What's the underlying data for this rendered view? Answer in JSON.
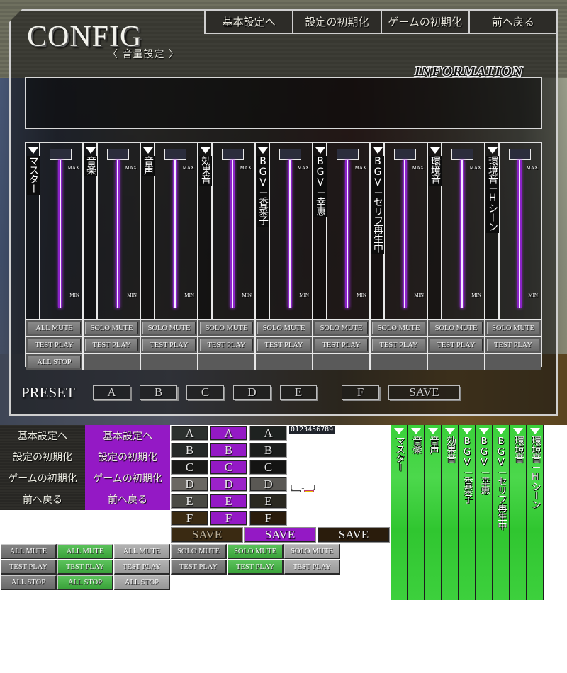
{
  "header": {
    "title": "CONFIG",
    "subtitle": "〈 音量設定 〉"
  },
  "top_nav": [
    {
      "label": "基本設定へ"
    },
    {
      "label": "設定の初期化"
    },
    {
      "label": "ゲームの初期化"
    },
    {
      "label": "前へ戻る"
    }
  ],
  "info": {
    "label": "INFORMATION",
    "text": ""
  },
  "mixer": {
    "max_label": "MAX",
    "min_label": "MIN",
    "channels": [
      {
        "name": "マスター"
      },
      {
        "name": "音楽"
      },
      {
        "name": "音声"
      },
      {
        "name": "効果音"
      },
      {
        "name": "BGV－香菜子"
      },
      {
        "name": "BGV－幸恵"
      },
      {
        "name": "BGV－セリフ再生中"
      },
      {
        "name": "環境音"
      },
      {
        "name": "環境音－Hシーン"
      }
    ],
    "all_mute": "ALL MUTE",
    "solo_mute": "SOLO MUTE",
    "test_play": "TEST PLAY",
    "all_stop": "ALL STOP"
  },
  "preset": {
    "label": "PRESET",
    "slots": [
      "A",
      "B",
      "C",
      "D",
      "E",
      "F"
    ],
    "save": "SAVE"
  },
  "sprites": {
    "nav_items": [
      "基本設定へ",
      "設定の初期化",
      "ゲームの初期化",
      "前へ戻る"
    ],
    "letters": [
      "A",
      "B",
      "C",
      "D",
      "E",
      "F"
    ],
    "digits": "0123456789",
    "save": "SAVE",
    "all_mute": "ALL MUTE",
    "solo_mute": "SOLO MUTE",
    "test_play": "TEST PLAY",
    "all_stop": "ALL STOP",
    "channel_names": [
      "マスター",
      "音楽",
      "音声",
      "効果音",
      "BGV－香菜子",
      "BGV－幸恵",
      "BGV－セリフ再生中",
      "環境音",
      "環境音－Hシーン"
    ]
  },
  "colors": {
    "accent_purple": "#9419c5",
    "slider_purple": "#8b23c8",
    "button_green": "#3aa23a",
    "label_green": "#33cc33"
  }
}
